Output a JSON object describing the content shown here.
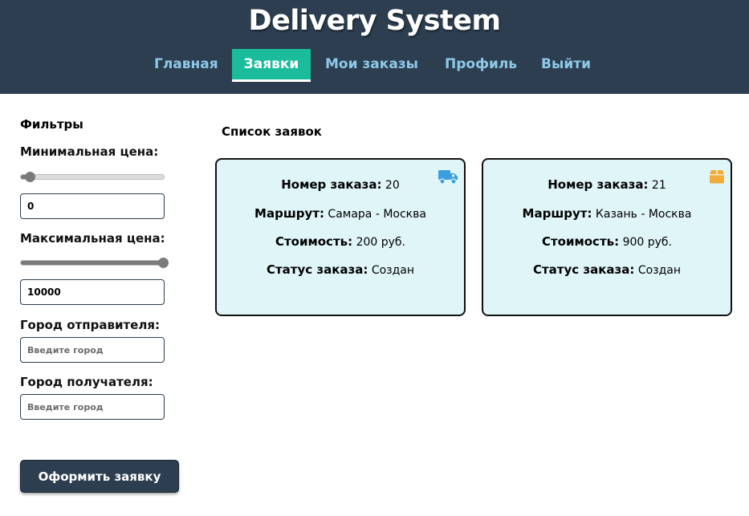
{
  "app": {
    "title": "Delivery System"
  },
  "nav": {
    "items": [
      {
        "label": "Главная"
      },
      {
        "label": "Заявки"
      },
      {
        "label": "Мои заказы"
      },
      {
        "label": "Профиль"
      },
      {
        "label": "Выйти"
      }
    ],
    "active_index": 1
  },
  "filters": {
    "title": "Фильтры",
    "min_price": {
      "label": "Минимальная цена:",
      "value": "0",
      "slider_fraction": 0.0
    },
    "max_price": {
      "label": "Максимальная цена:",
      "value": "10000",
      "slider_fraction": 1.0
    },
    "sender_city": {
      "label": "Город отправителя:",
      "placeholder": "Введите город"
    },
    "recipient_city": {
      "label": "Город получателя:",
      "placeholder": "Введите город"
    },
    "submit_label": "Оформить заявку"
  },
  "list": {
    "title": "Список заявок",
    "fields": {
      "number": "Номер заказа:",
      "route": "Маршрут:",
      "cost": "Стоимость:",
      "status": "Статус заказа:"
    },
    "orders": [
      {
        "number": "20",
        "route": "Самара - Москва",
        "cost": "200 руб.",
        "status": "Создан",
        "icon": "truck-icon",
        "icon_color": "#3b9ee0"
      },
      {
        "number": "21",
        "route": "Казань - Москва",
        "cost": "900 руб.",
        "status": "Создан",
        "icon": "box-icon",
        "icon_color": "#f0ad3c"
      }
    ]
  },
  "colors": {
    "header_bg": "#2c3e50",
    "nav_text": "#8ec9e8",
    "nav_active": "#1abc9c",
    "card_bg": "#dff5f8"
  }
}
